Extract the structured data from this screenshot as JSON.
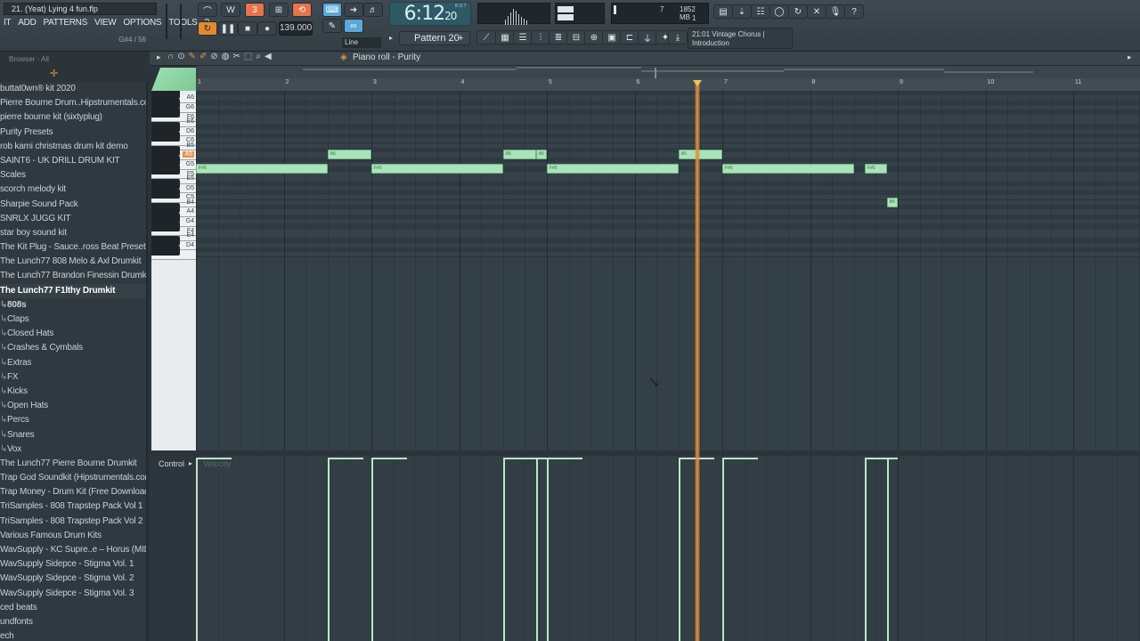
{
  "window": {
    "project_title": "21. (Yeat) Lying 4 fun.flp",
    "menu": [
      "IT",
      "ADD",
      "PATTERNS",
      "VIEW",
      "OPTIONS",
      "TOOLS",
      "?"
    ],
    "hint_readout": "G#4 / 56"
  },
  "transport": {
    "tempo": "139.000",
    "song_time_main": "6:12",
    "song_time_sub": "20",
    "time_label": "B:S:T",
    "pattern": "Pattern 20",
    "snap_mode": "Line"
  },
  "system": {
    "mem": "1852 MB",
    "cpu_value": "7",
    "voices": "1"
  },
  "hint_panel": {
    "line1": "21:01  Vintage Chorus |",
    "line2": "Introduction"
  },
  "browser": {
    "header": "Browser - All",
    "items": [
      {
        "label": "buttat0wn® kit 2020",
        "icon": ""
      },
      {
        "label": "Pierre Bourne Drum..Hipstrumentals.com)",
        "icon": ""
      },
      {
        "label": "pierre bourne kit (sixtyplug)",
        "icon": ""
      },
      {
        "label": "Purity Presets",
        "icon": ""
      },
      {
        "label": "rob kami christmas drum kit demo",
        "icon": ""
      },
      {
        "label": "SAINT6 - UK DRILL DRUM KIT",
        "icon": ""
      },
      {
        "label": "Scales",
        "icon": ""
      },
      {
        "label": "scorch melody kit",
        "icon": ""
      },
      {
        "label": "Sharpie Sound Pack",
        "icon": ""
      },
      {
        "label": "SNRLX JUGG KIT",
        "icon": ""
      },
      {
        "label": "star boy sound kit",
        "icon": ""
      },
      {
        "label": "The Kit Plug - Sauce..ross Beat Preset Bank)",
        "icon": ""
      },
      {
        "label": "The Lunch77 808 Melo & Axl Drumkit",
        "icon": ""
      },
      {
        "label": "The Lunch77 Brandon Finessin Drumkit",
        "icon": ""
      },
      {
        "label": "The Lunch77 F1lthy Drumkit",
        "icon": "",
        "selected": true
      },
      {
        "label": "808s",
        "icon": "folder",
        "bold": true
      },
      {
        "label": "Claps",
        "icon": "folder"
      },
      {
        "label": "Closed Hats",
        "icon": "folder"
      },
      {
        "label": "Crashes & Cymbals",
        "icon": "folder"
      },
      {
        "label": "Extras",
        "icon": "folder"
      },
      {
        "label": "FX",
        "icon": "folder"
      },
      {
        "label": "Kicks",
        "icon": "folder"
      },
      {
        "label": "Open Hats",
        "icon": "folder"
      },
      {
        "label": "Percs",
        "icon": "folder"
      },
      {
        "label": "Snares",
        "icon": "folder"
      },
      {
        "label": "Vox",
        "icon": "folder"
      },
      {
        "label": "The Lunch77 Pierre Bourne Drumkit",
        "icon": ""
      },
      {
        "label": "Trap God Soundkit (Hipstrumentals.com)",
        "icon": ""
      },
      {
        "label": "Trap Money - Drum Kit (Free Download)",
        "icon": ""
      },
      {
        "label": "TriSamples - 808 Trapstep Pack Vol 1",
        "icon": ""
      },
      {
        "label": "TriSamples - 808 Trapstep Pack Vol 2",
        "icon": ""
      },
      {
        "label": "Various Famous Drum Kits",
        "icon": ""
      },
      {
        "label": "WavSupply - KC Supre..e – Horus (MIDI Kit)",
        "icon": ""
      },
      {
        "label": "WavSupply Sidepce - Stigma Vol. 1",
        "icon": ""
      },
      {
        "label": "WavSupply Sidepce - Stigma Vol. 2",
        "icon": ""
      },
      {
        "label": "WavSupply Sidepce - Stigma Vol. 3",
        "icon": ""
      },
      {
        "label": "ced beats",
        "icon": ""
      },
      {
        "label": "undfonts",
        "icon": ""
      },
      {
        "label": "ech",
        "icon": ""
      }
    ]
  },
  "piano_roll": {
    "title": "Piano roll - Purity",
    "bars": [
      "1",
      "2",
      "3",
      "4",
      "5",
      "6",
      "7",
      "8",
      "9",
      "10",
      "11"
    ],
    "key_labels": [
      "A6",
      "G6",
      "F6",
      "E6",
      "D6",
      "C6",
      "B5",
      "A5",
      "G5",
      "F5",
      "E5",
      "D5",
      "C5",
      "B4",
      "A4",
      "G4",
      "F4",
      "E4",
      "D4"
    ],
    "highlight_key": "A5",
    "notes": [
      {
        "pitch": "F#5",
        "start": 1.0,
        "length": 1.5
      },
      {
        "pitch": "A5",
        "start": 2.5,
        "length": 0.5
      },
      {
        "pitch": "F#5",
        "start": 3.0,
        "length": 1.5
      },
      {
        "pitch": "A5",
        "start": 4.5,
        "length": 0.375
      },
      {
        "pitch": "A5",
        "start": 4.875,
        "length": 0.125
      },
      {
        "pitch": "F#5",
        "start": 5.0,
        "length": 1.5
      },
      {
        "pitch": "A5",
        "start": 6.5,
        "length": 0.5
      },
      {
        "pitch": "F#5",
        "start": 7.0,
        "length": 1.5
      },
      {
        "pitch": "F#5",
        "start": 8.625,
        "length": 0.25
      },
      {
        "pitch": "B4",
        "start": 8.875,
        "length": 0.125
      }
    ],
    "playhead_bar": 6.72
  },
  "control": {
    "label": "Control",
    "lane": "Velocity"
  },
  "colors": {
    "note_fill": "#a9e4b8",
    "playhead": "#e28a3a",
    "highlight_key": "#e6923f"
  }
}
